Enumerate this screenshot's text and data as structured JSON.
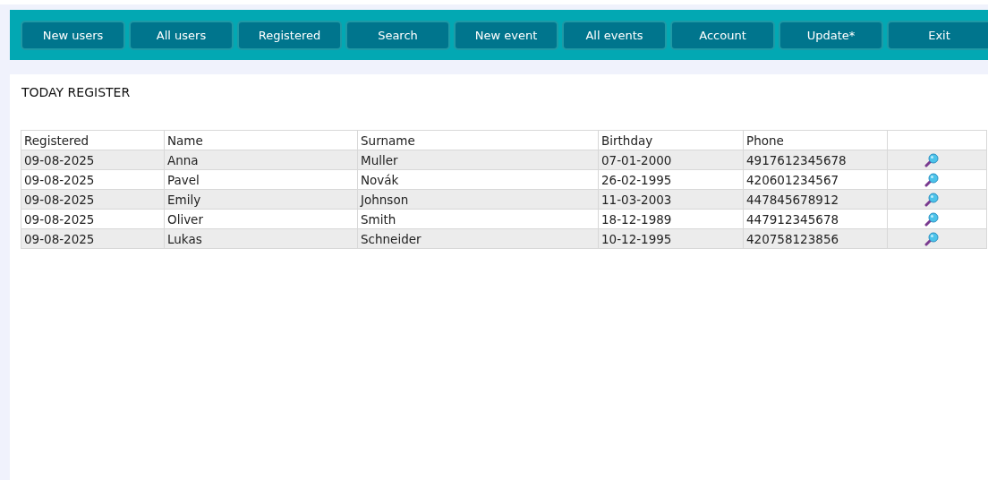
{
  "nav": [
    {
      "label": "New users"
    },
    {
      "label": "All users"
    },
    {
      "label": "Registered"
    },
    {
      "label": "Search"
    },
    {
      "label": "New event"
    },
    {
      "label": "All events"
    },
    {
      "label": "Account"
    },
    {
      "label": "Update*"
    },
    {
      "label": "Exit"
    }
  ],
  "title": "TODAY REGISTER",
  "table": {
    "columns": [
      "Registered",
      "Name",
      "Surname",
      "Birthday",
      "Phone"
    ],
    "rows": [
      {
        "registered": "09-08-2025",
        "name": "Anna",
        "surname": "Muller",
        "birthday": "07-01-2000",
        "phone": "4917612345678"
      },
      {
        "registered": "09-08-2025",
        "name": "Pavel",
        "surname": "Novák",
        "birthday": "26-02-1995",
        "phone": "420601234567"
      },
      {
        "registered": "09-08-2025",
        "name": "Emily",
        "surname": "Johnson",
        "birthday": "11-03-2003",
        "phone": "447845678912"
      },
      {
        "registered": "09-08-2025",
        "name": "Oliver",
        "surname": "Smith",
        "birthday": "18-12-1989",
        "phone": "447912345678"
      },
      {
        "registered": "09-08-2025",
        "name": "Lukas",
        "surname": "Schneider",
        "birthday": "10-12-1995",
        "phone": "420758123856"
      }
    ]
  }
}
